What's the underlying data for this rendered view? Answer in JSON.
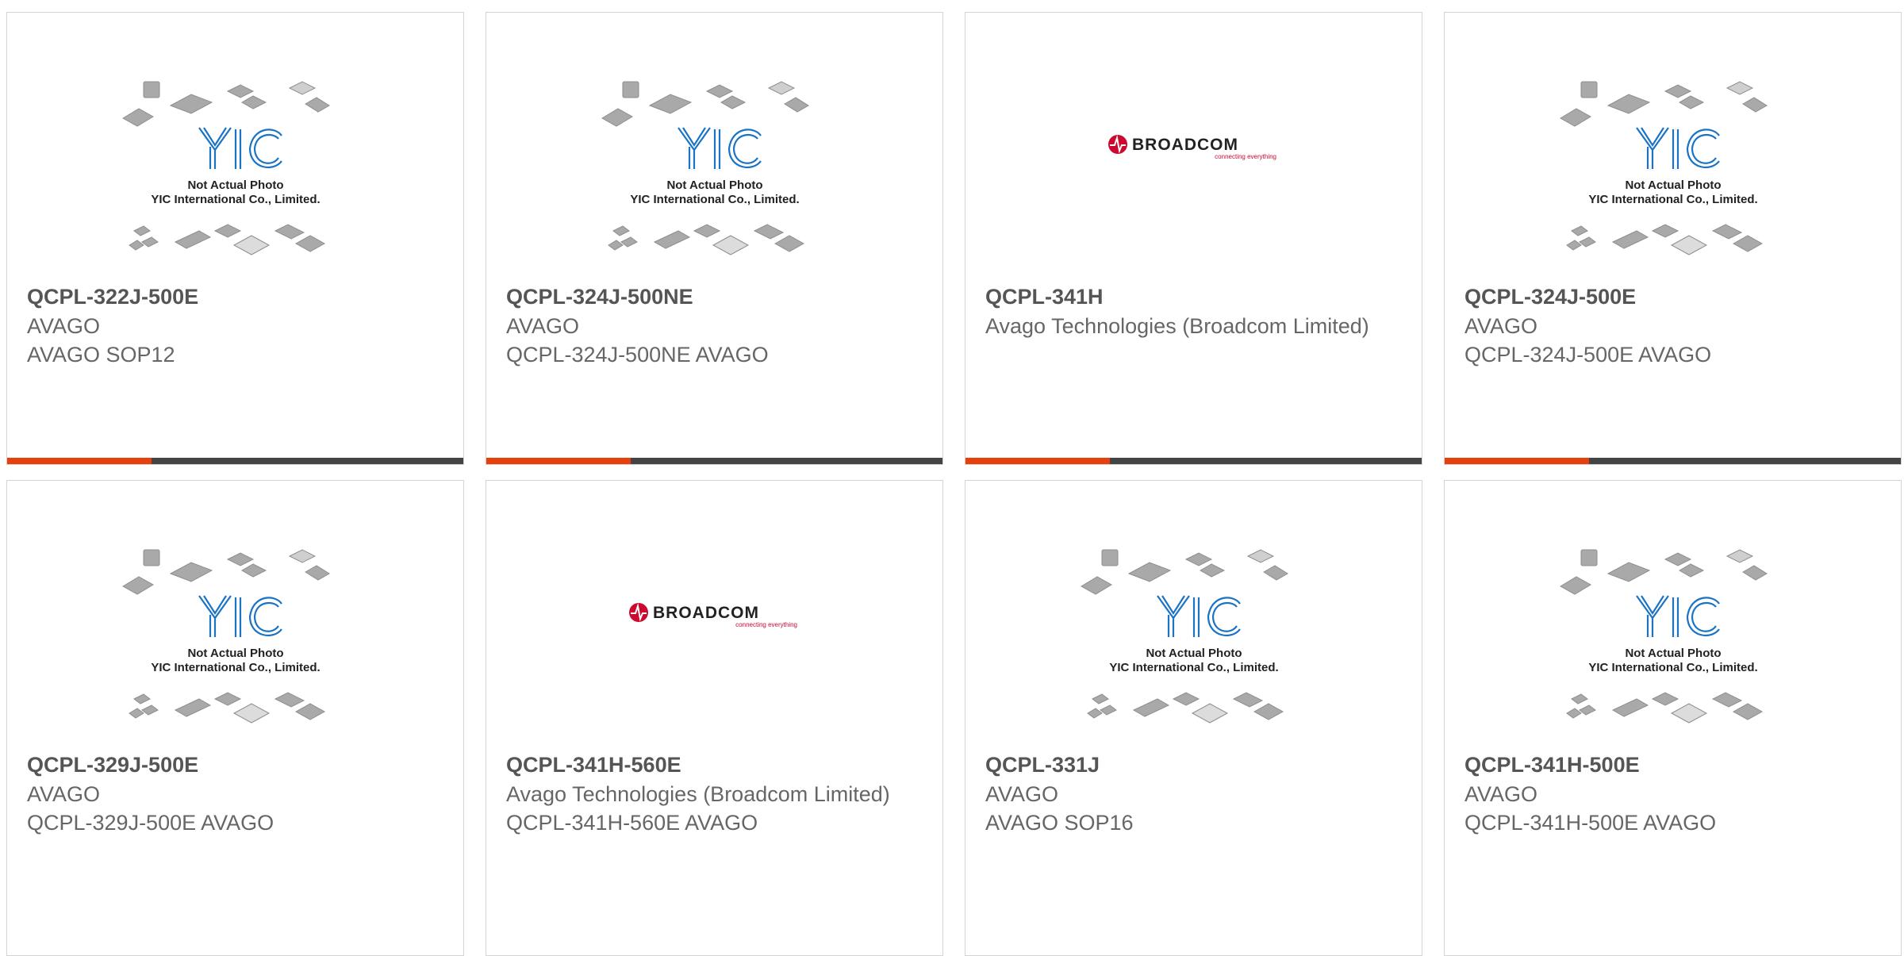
{
  "colors": {
    "accent": "#e8400c",
    "bar": "#444444",
    "name_text": "#555555",
    "meta_text": "#666666",
    "yic_blue": "#1a73c4",
    "broadcom_red": "#cc092f"
  },
  "placeholder": {
    "line1": "Not Actual Photo",
    "line2": "YIC International Co., Limited.",
    "logo": "YIC"
  },
  "broadcom": {
    "wordmark": "BROADCOM",
    "tagline": "connecting everything"
  },
  "products": [
    {
      "name": "QCPL-322J-500E",
      "image": "placeholder",
      "lines": [
        "AVAGO",
        "AVAGO SOP12"
      ]
    },
    {
      "name": "QCPL-324J-500NE",
      "image": "placeholder",
      "lines": [
        "AVAGO",
        "QCPL-324J-500NE AVAGO"
      ]
    },
    {
      "name": "QCPL-341H",
      "image": "broadcom",
      "lines": [
        "Avago Technologies (Broadcom Limited)"
      ]
    },
    {
      "name": "QCPL-324J-500E",
      "image": "placeholder",
      "lines": [
        "AVAGO",
        "QCPL-324J-500E AVAGO"
      ]
    },
    {
      "name": "QCPL-329J-500E",
      "image": "placeholder",
      "lines": [
        "AVAGO",
        "QCPL-329J-500E AVAGO"
      ]
    },
    {
      "name": "QCPL-341H-560E",
      "image": "broadcom",
      "lines": [
        "Avago Technologies (Broadcom Limited)",
        "QCPL-341H-560E AVAGO"
      ]
    },
    {
      "name": "QCPL-331J",
      "image": "placeholder",
      "lines": [
        "AVAGO",
        "AVAGO SOP16"
      ]
    },
    {
      "name": "QCPL-341H-500E",
      "image": "placeholder",
      "lines": [
        "AVAGO",
        "QCPL-341H-500E AVAGO"
      ]
    }
  ]
}
